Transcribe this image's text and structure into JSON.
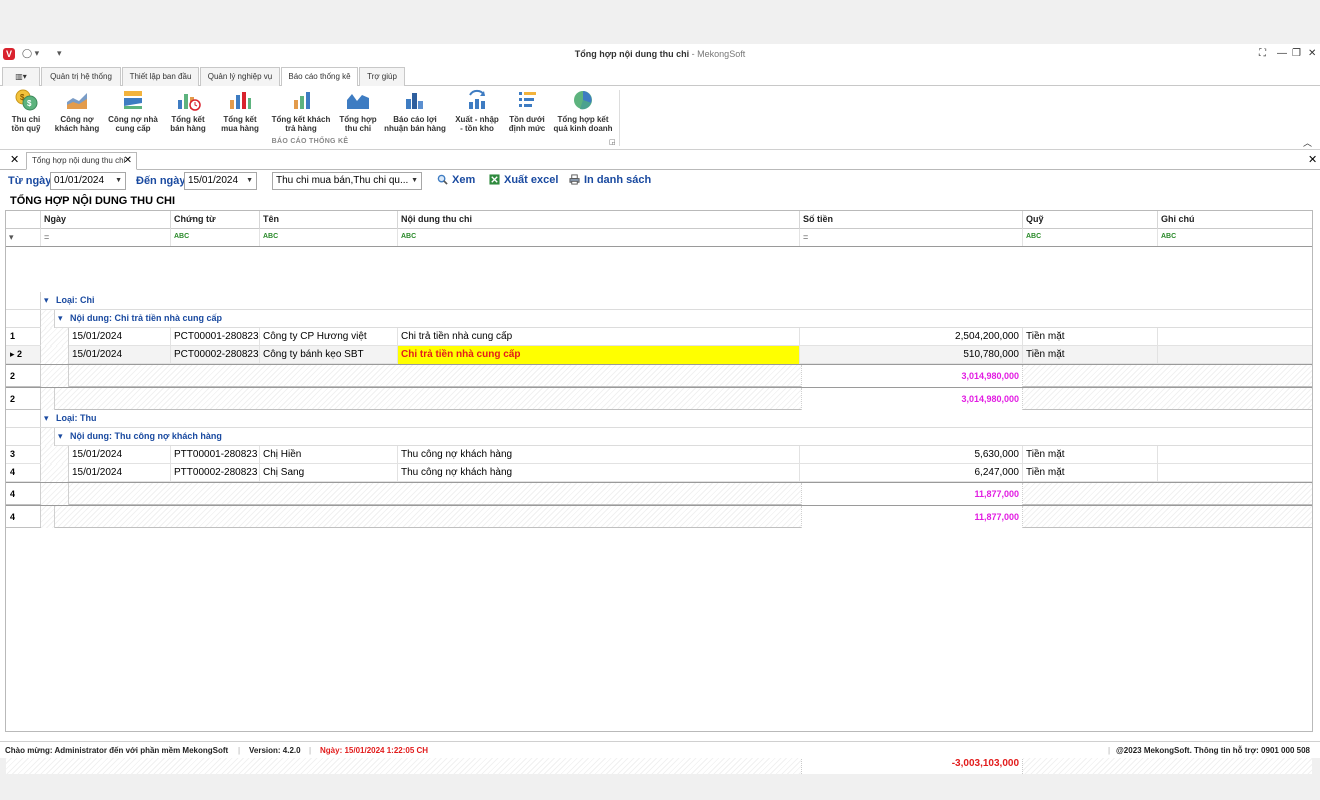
{
  "window": {
    "title": "Tổng hợp nội dung thu chi",
    "app_suffix": " - MekongSoft",
    "app_logo": "V"
  },
  "ribbon": {
    "tabs": [
      "Quản trị hệ thống",
      "Thiết lập ban đầu",
      "Quản lý nghiệp vụ",
      "Báo cáo thống kê",
      "Trợ giúp"
    ],
    "active_tab": "Báo cáo thống kê",
    "buttons": [
      {
        "label": "Thu chi\ntồn quỹ",
        "icon": "coins-icon"
      },
      {
        "label": "Công nợ\nkhách hàng",
        "icon": "area-chart-icon"
      },
      {
        "label": "Công nợ nhà\ncung cấp",
        "icon": "layers-chart-icon"
      },
      {
        "label": "Tổng kết\nbán hàng",
        "icon": "bar-clock-icon"
      },
      {
        "label": "Tổng kết\nmua hàng",
        "icon": "bar-chart-icon"
      },
      {
        "label": "Tổng kết khách\ntrả hàng",
        "icon": "bar-chart-small-icon"
      },
      {
        "label": "Tổng hợp\nthu chi",
        "icon": "wave-chart-icon"
      },
      {
        "label": "Báo cáo lợi\nnhuận bán hàng",
        "icon": "profit-bars-icon"
      },
      {
        "label": "Xuất - nhập\n- tồn kho",
        "icon": "refresh-bars-icon"
      },
      {
        "label": "Tồn dưới\nđịnh mức",
        "icon": "list-icon"
      },
      {
        "label": "Tổng hợp kết\nquả kinh doanh",
        "icon": "pie-chart-icon"
      }
    ],
    "group_label": "BÁO CÁO THỐNG KÊ"
  },
  "doc_tab": {
    "label": "Tổng hợp nội dung thu chi"
  },
  "filters": {
    "from_label": "Từ ngày",
    "from_value": "01/01/2024",
    "to_label": "Đến ngày",
    "to_value": "15/01/2024",
    "type_value": "Thu chi mua bán,Thu chi qu...",
    "view_label": "Xem",
    "excel_label": "Xuất excel",
    "print_label": "In danh sách"
  },
  "report_title": "TỔNG HỢP NỘI DUNG THU CHI",
  "grid": {
    "columns": [
      "Ngày",
      "Chứng từ",
      "Tên",
      "Nội dung thu chi",
      "Số tiền",
      "Quỹ",
      "Ghi chú"
    ],
    "filter_ops": [
      "=",
      "ABC",
      "ABC",
      "ABC",
      "=",
      "ABC",
      "ABC"
    ],
    "groups": [
      {
        "type_label": "Loại: Chi",
        "content_label": "Nội dung: Chi trả tiền nhà cung cấp",
        "rows": [
          {
            "idx": "1",
            "date": "15/01/2024",
            "voucher": "PCT00001-280823",
            "name": "Công ty CP Hương việt",
            "content": "Chi trả tiền nhà cung cấp",
            "amount": "2,504,200,000",
            "fund": "Tiền mặt",
            "note": ""
          },
          {
            "idx": "2",
            "date": "15/01/2024",
            "voucher": "PCT00002-280823",
            "name": "Công ty bánh kẹo SBT",
            "content": "Chi trả tiền nhà cung cấp",
            "amount": "510,780,000",
            "fund": "Tiền mặt",
            "note": "",
            "selected": true
          }
        ],
        "content_count": "2",
        "content_total": "3,014,980,000",
        "type_count": "2",
        "type_total": "3,014,980,000"
      },
      {
        "type_label": "Loại: Thu",
        "content_label": "Nội dung: Thu công nợ khách hàng",
        "rows": [
          {
            "idx": "3",
            "date": "15/01/2024",
            "voucher": "PTT00001-280823",
            "name": "Chị Hiền",
            "content": "Thu công nợ khách hàng",
            "amount": "5,630,000",
            "fund": "Tiền mặt",
            "note": ""
          },
          {
            "idx": "4",
            "date": "15/01/2024",
            "voucher": "PTT00002-280823",
            "name": "Chị Sang",
            "content": "Thu công nợ khách hàng",
            "amount": "6,247,000",
            "fund": "Tiền mặt",
            "note": ""
          }
        ],
        "content_count": "4",
        "content_total": "11,877,000",
        "type_count": "4",
        "type_total": "11,877,000"
      }
    ],
    "grand_total": "-3,003,103,000"
  },
  "statusbar": {
    "welcome": "Chào mừng: Administrator đến với phần mềm MekongSoft",
    "version": "Version: 4.2.0",
    "date": "Ngày: 15/01/2024 1:22:05 CH",
    "copyright": "@2023 MekongSoft. Thông tin hỗ trợ: 0901 000 508"
  },
  "colors": {
    "label_blue": "#1a4aa0",
    "total_magenta": "#e21ce2",
    "grand_red": "#e21c1c",
    "selected_yellow": "#ffff00",
    "status_red": "#e21c1c"
  }
}
